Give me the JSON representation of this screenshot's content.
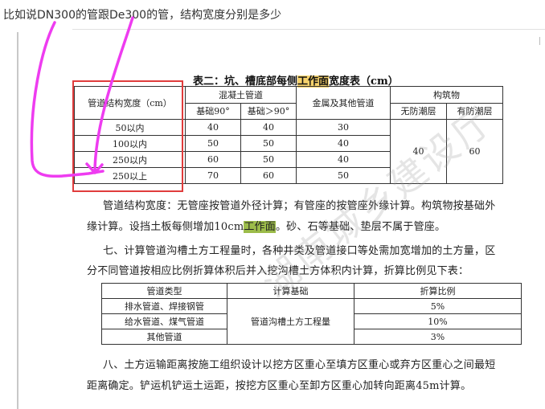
{
  "question": "比如说DN300的管跟De300的管，结构宽度分别是多少",
  "table1": {
    "title_before": "表二：坑、槽底部每侧",
    "title_highlight": "工作面",
    "title_after": "宽度表（cm）",
    "header": {
      "pipe_width": "管道结构宽度（cm）",
      "concrete": "混凝土管道",
      "base90": "基础90°",
      "base_gt90": "基础＞90°",
      "metal": "金属及其他管道",
      "structure": "构筑物",
      "no_waterproof": "无防潮层",
      "waterproof": "有防潮层"
    },
    "rows": [
      {
        "label": "50以内",
        "b90": "40",
        "bgt90": "40",
        "metal": "30"
      },
      {
        "label": "100以内",
        "b90": "50",
        "bgt90": "50",
        "metal": "40"
      },
      {
        "label": "250以内",
        "b90": "60",
        "bgt90": "50",
        "metal": "40"
      },
      {
        "label": "250以上",
        "b90": "70",
        "bgt90": "60",
        "metal": "50"
      }
    ],
    "structure_no_waterproof": "40",
    "structure_waterproof": "60"
  },
  "para1_line1": "管道结构宽度：无管座按管道外径计算；有管座的按管座外缘计算。构筑物按基础外",
  "para1_line2_before": "缘计算。设挡土板每侧增加10cm",
  "para1_line2_highlight": "工作面",
  "para1_line2_after": "。砂、石等基础、垫层不属于管座。",
  "para2_line1": "七、计算管道沟槽土方工程量时，各种井类及管道接口等处需加宽增加的土方量，区",
  "para2_line2": "分不同管道按相应比例折算体积后并入挖沟槽土方体积内计算，折算比例见下表：",
  "table2": {
    "header": {
      "type": "管道类型",
      "basis": "计算基础",
      "ratio": "折算比例"
    },
    "rows": [
      {
        "type": "排水管道、焊接钢管",
        "ratio": "5%"
      },
      {
        "type": "给水管道、煤气管道",
        "ratio": "10%"
      },
      {
        "type": "其他管道",
        "ratio": "3%"
      }
    ],
    "basis_value": "管道沟槽土方工程量"
  },
  "para3_line1": "八、土方运输距离按施工组织设计以挖方区重心至填方区重心或弃方区重心之间最短",
  "para3_line2": "距离确定。铲运机铲运土运距，按挖方区重心至卸方区重心加转向距离45m计算。",
  "watermark": "湖南城乡建设厅",
  "colors": {
    "annotation_magenta": "#ee3cf0",
    "annotation_red": "#e03c3c",
    "highlight_orange": "#f6d26b",
    "highlight_green": "#9cbc4a"
  }
}
